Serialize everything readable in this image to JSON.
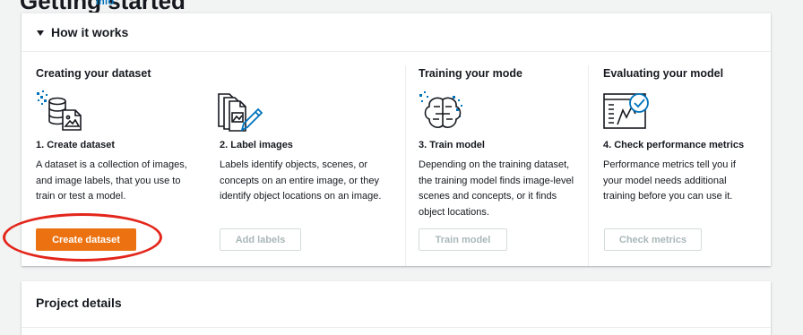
{
  "page": {
    "title": "Getting started",
    "info_link": "Info"
  },
  "how_it_works": {
    "title": "How it works",
    "columns": [
      {
        "heading": "Creating your dataset",
        "steps": [
          {
            "title": "1. Create dataset",
            "description": "A dataset is a collection of images, and image labels, that you use to train or test a model.",
            "button": "Create dataset",
            "icon": "dataset-icon"
          },
          {
            "title": "2. Label images",
            "description": "Labels identify objects, scenes, or concepts on an entire image, or they identify object locations on an image.",
            "button": "Add labels",
            "icon": "label-images-icon"
          }
        ]
      },
      {
        "heading": "Training your mode",
        "steps": [
          {
            "title": "3. Train model",
            "description": "Depending on the training dataset, the training model finds image-level scenes and concepts, or it finds object locations.",
            "button": "Train model",
            "icon": "brain-icon"
          }
        ]
      },
      {
        "heading": "Evaluating your model",
        "steps": [
          {
            "title": "4. Check performance metrics",
            "description": "Performance metrics tell you if your model needs additional training before you can use it.",
            "button": "Check metrics",
            "icon": "metrics-icon"
          }
        ]
      }
    ]
  },
  "project_details": {
    "title": "Project details"
  },
  "colors": {
    "primary": "#ec7211",
    "annotation": "#e3261b",
    "icon_blue": "#0073bb"
  }
}
